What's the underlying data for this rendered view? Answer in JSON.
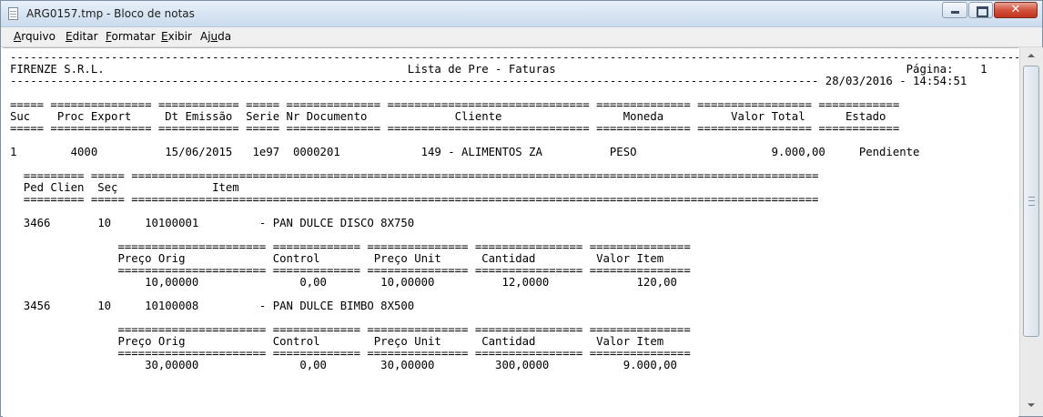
{
  "window": {
    "title": "ARG0157.tmp - Bloco de notas",
    "controls": {
      "minimize": "—",
      "maximize": "□",
      "close": "✕"
    }
  },
  "menu": [
    {
      "label_u": "A",
      "label_rest": "rquivo"
    },
    {
      "label_u": "E",
      "label_rest": "ditar"
    },
    {
      "label_u": "F",
      "label_rest": "ormatar"
    },
    {
      "label_u": "E",
      "label_rest": "xibir"
    },
    {
      "label_pre": "Aj",
      "label_u": "u",
      "label_rest": "da"
    }
  ],
  "document": {
    "lines": [
      "----------------------------------------------------------------------------------------------------------------------------------------------------------",
      "FIRENZE S.R.L.                                             Lista de Pre - Faturas                                                    Página:    1",
      "------------------------------------------------------------------------------------------------------------------------ 28/03/2016 - 14:54:51",
      "",
      "===== =============== ============ ===== ============== ============================== ============== ================= ============",
      "Suc    Proc Export     Dt Emissão  Serie Nr Documento             Cliente                  Moneda          Valor Total      Estado",
      "===== =============== ============ ===== ============== ============================== ============== ================= ============",
      "",
      "1        4000          15/06/2015   1e97  0000201            149 - ALIMENTOS ZA          PESO                    9.000,00     Pendiente",
      "",
      "  ========= ===== ======================================================================================================",
      "  Ped Clien  Seç              Item",
      "  ========= ===== ======================================================================================================",
      "",
      "  3466       10     10100001         - PAN DULCE DISCO 8X750",
      "",
      "                ====================== ============= =============== ================ ===============",
      "                Preço Orig             Control        Preço Unit      Cantidad         Valor Item",
      "                ====================== ============= =============== ================ ===============",
      "                    10,00000               0,00        10,00000          12,0000             120,00",
      "",
      "  3456       10     10100008         - PAN DULCE BIMBO 8X500",
      "",
      "                ====================== ============= =============== ================ ===============",
      "                Preço Orig             Control        Preço Unit      Cantidad         Valor Item",
      "                ====================== ============= =============== ================ ===============",
      "                    30,00000               0,00        30,00000         300,0000           9.000,00"
    ]
  }
}
